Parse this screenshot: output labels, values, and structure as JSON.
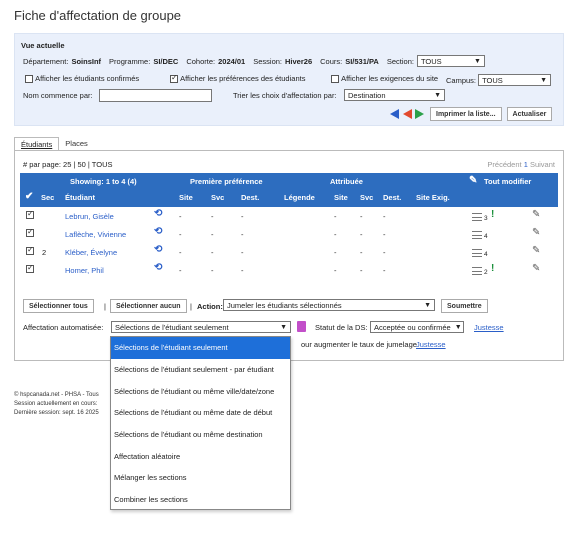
{
  "page": {
    "title": "Fiche d'affectation de groupe"
  },
  "vue": {
    "title": "Vue actuelle",
    "departement_label": "Département:",
    "departement": "SoinsInf",
    "programme_label": "Programme:",
    "programme": "SI/DEC",
    "cohorte_label": "Cohorte:",
    "cohorte": "2024/01",
    "session_label": "Session:",
    "session": "Hiver26",
    "cours_label": "Cours:",
    "cours": "SI/531/PA",
    "section_label": "Section:",
    "section": "TOUS",
    "chk_confirmes": "Afficher les étudiants confirmés",
    "chk_preferences": "Afficher les préférences des étudiants",
    "chk_exigences": "Afficher les exigences du site",
    "campus_label": "Campus:",
    "campus": "TOUS",
    "nom_label": "Nom commence par:",
    "nom_value": "",
    "trier_label": "Trier les choix d'affectation par:",
    "trier": "Destination",
    "imprimer": "Imprimer la liste...",
    "actualiser": "Actualiser"
  },
  "tabs": [
    {
      "label": "Étudiants"
    },
    {
      "label": "Places"
    }
  ],
  "grid": {
    "perpage": "# par page: 25 | 50 | TOUS",
    "pager_prev": "Précédent",
    "pager_cur": "1",
    "pager_next": "Suivant",
    "showing": "Showing: 1 to 4 (4)",
    "premiere": "Première préférence",
    "attribuee": "Attribuée",
    "tout_modifier": "Tout modifier",
    "col_sec": "Sec",
    "col_etudiant": "Étudiant",
    "col_site1": "Site",
    "col_svc1": "Svc",
    "col_dest1": "Dest.",
    "col_legende": "Légende",
    "col_site2": "Site",
    "col_svc2": "Svc",
    "col_dest2": "Dest.",
    "col_siteexig": "Site Exig.",
    "rows": [
      {
        "sec": "",
        "name": "Lebrun, Gisèle",
        "c1": "-",
        "c2": "-",
        "c3": "-",
        "c4": "-",
        "c5": "-",
        "c6": "-",
        "count": "3",
        "flag": true
      },
      {
        "sec": "",
        "name": "Laflèche, Vivienne",
        "c1": "-",
        "c2": "-",
        "c3": "-",
        "c4": "-",
        "c5": "-",
        "c6": "-",
        "count": "4",
        "flag": false
      },
      {
        "sec": "2",
        "name": "Kléber, Évelyne",
        "c1": "-",
        "c2": "-",
        "c3": "-",
        "c4": "-",
        "c5": "-",
        "c6": "-",
        "count": "4",
        "flag": false
      },
      {
        "sec": "",
        "name": "Homer, Phil",
        "c1": "-",
        "c2": "-",
        "c3": "-",
        "c4": "-",
        "c5": "-",
        "c6": "-",
        "count": "2",
        "flag": true
      }
    ]
  },
  "actions": {
    "selectionner_tous": "Sélectionner tous",
    "selectionner_aucun": "Sélectionner aucun",
    "sep": "|",
    "action_label": "Action:",
    "action_value": "Jumeler les étudiants sélectionnés",
    "soumettre": "Soumettre",
    "auto_label": "Affectation automatisée:",
    "auto_value": "Sélections de l'étudiant seulement",
    "statut_label": "Statut de la DS:",
    "statut_value": "Acceptée ou confirmée",
    "justesse": "Justesse",
    "augmenter": "our augmenter le taux de jumelage",
    "augmenter_link": "Justesse"
  },
  "dropdown": {
    "options": [
      "Sélections de l'étudiant seulement",
      "Sélections de l'étudiant seulement - par étudiant",
      "Sélections de l'étudiant ou même ville/date/zone",
      "Sélections de l'étudiant ou même date de début",
      "Sélections de l'étudiant ou même destination",
      "Affectation aléatoire",
      "Mélanger les sections",
      "Combiner les sections"
    ]
  },
  "footer": {
    "line1": "© hspcanada.net - PHSA - Tous",
    "line2": "Session actuellement en cours:",
    "line3": "Dernière session: sept. 16 2025"
  },
  "colors": {
    "accent": "#2d6dbf",
    "panel": "#eaf0fb",
    "highlight": "#1e6fd9"
  }
}
